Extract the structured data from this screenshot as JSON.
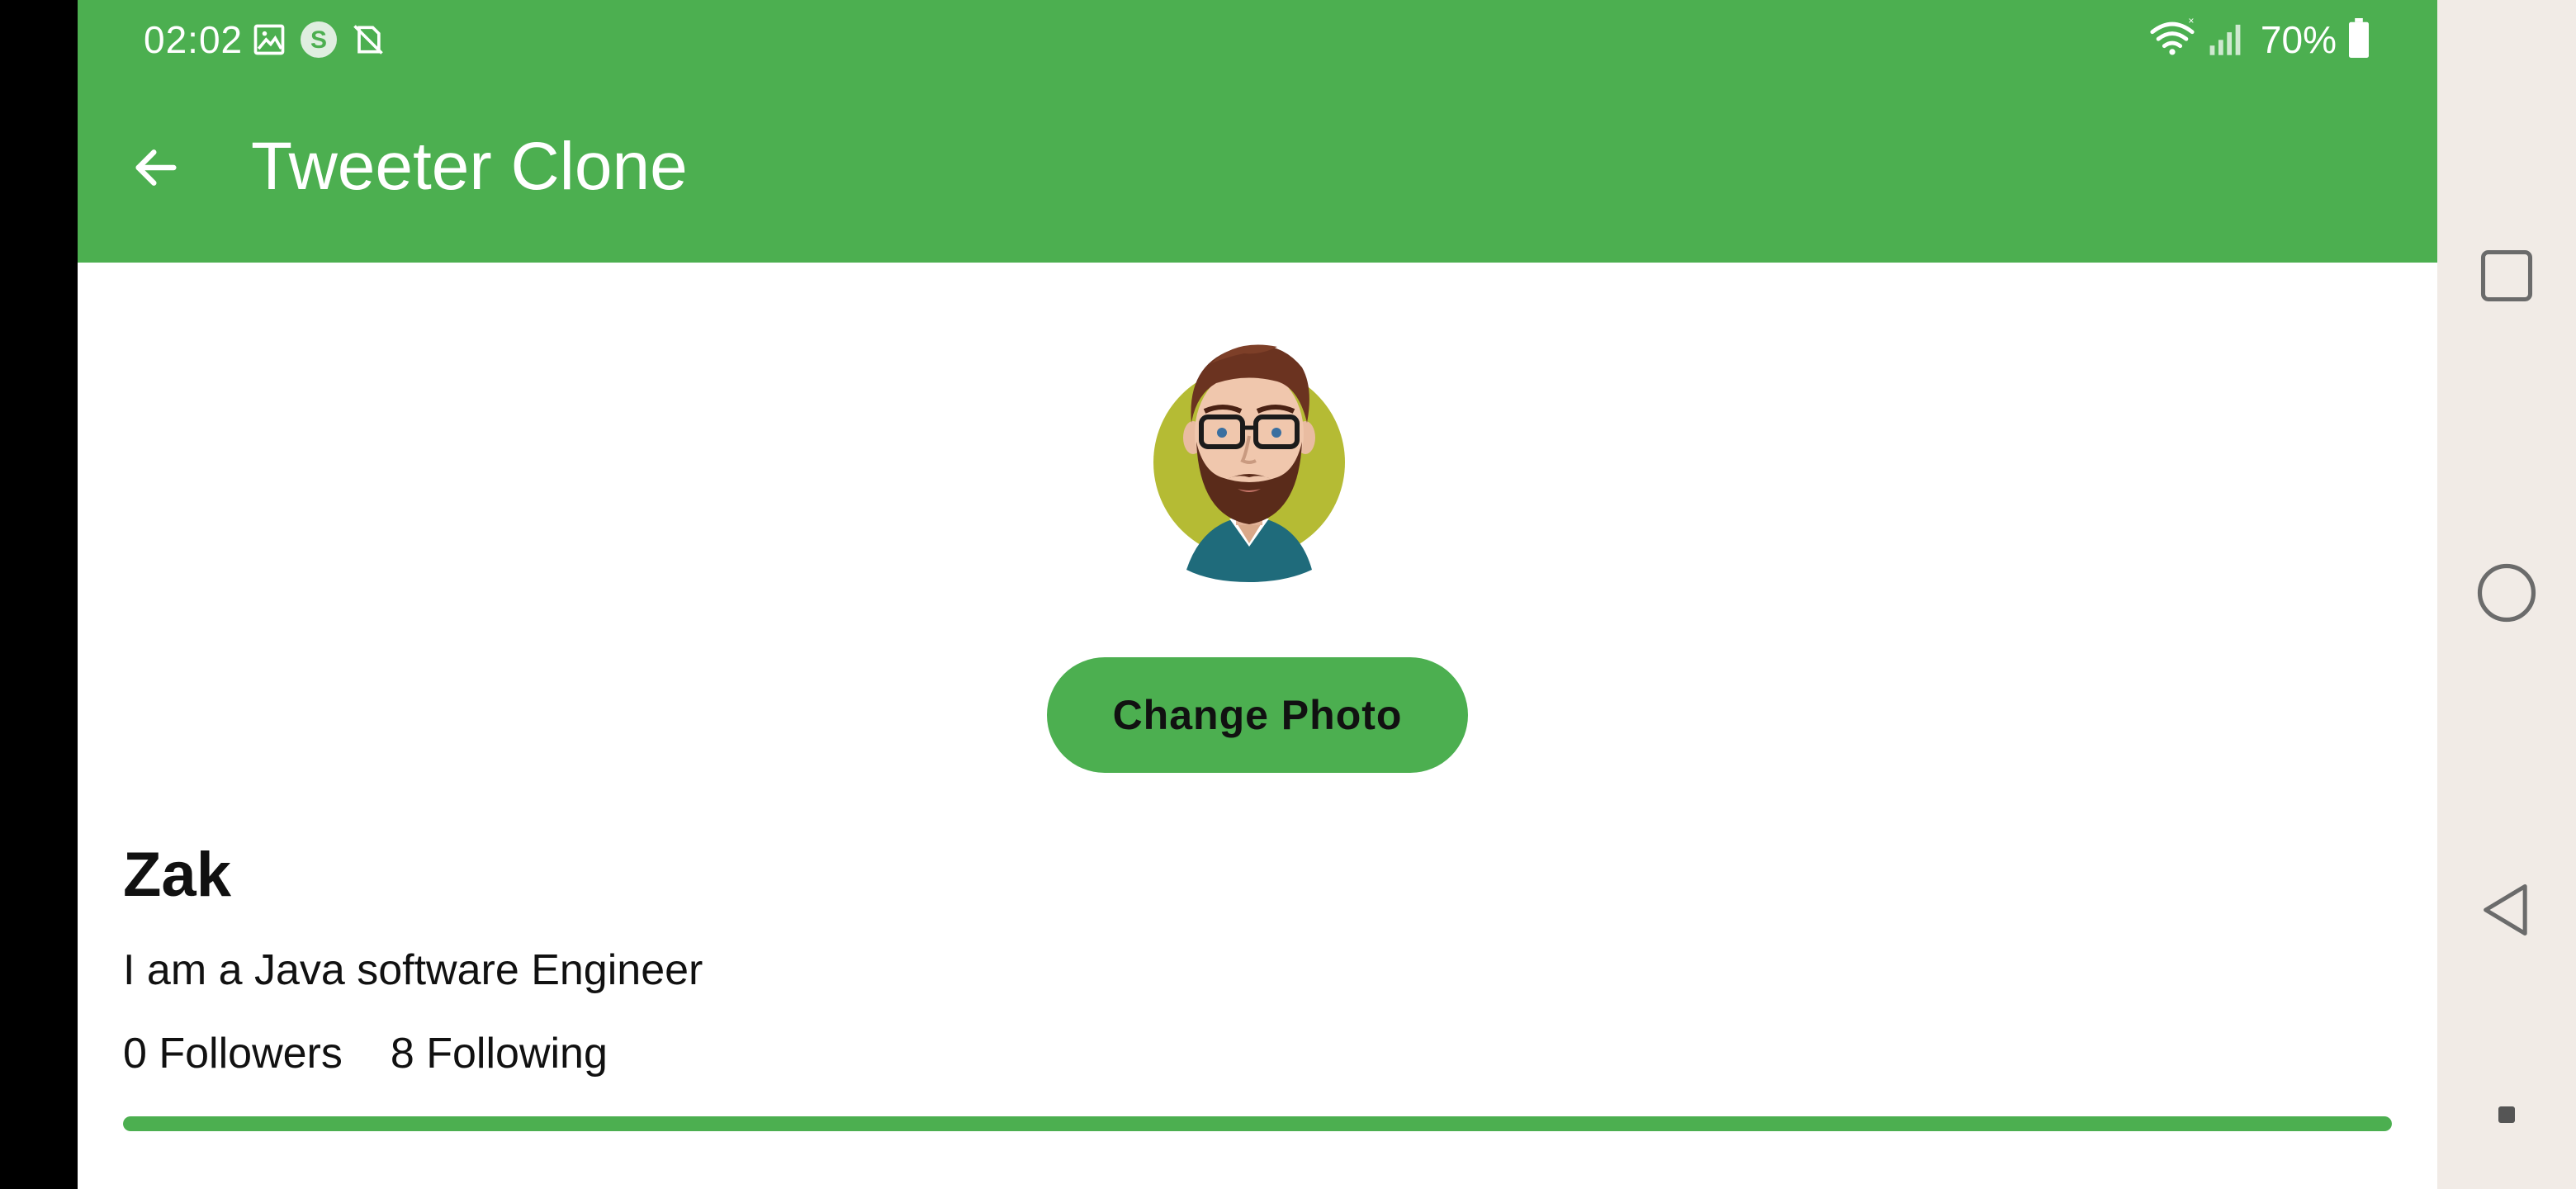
{
  "status_bar": {
    "time": "02:02",
    "battery_percent": "70%",
    "icons": [
      "image-icon",
      "skype-icon",
      "no-sim-icon",
      "wifi-icon",
      "signal-icon",
      "battery-icon"
    ]
  },
  "toolbar": {
    "title": "Tweeter Clone",
    "back_icon": "arrow-back-icon"
  },
  "profile": {
    "change_photo_label": "Change Photo",
    "name": "Zak",
    "bio": "I am a Java software Engineer",
    "followers": "0 Followers",
    "following": "8 Following",
    "progress": 1.0
  },
  "navigation_bar": {
    "icons": [
      "recents-square-icon",
      "home-circle-icon",
      "back-triangle-icon",
      "accessibility-dot-icon"
    ]
  },
  "colors": {
    "primary": "#4caf50",
    "background": "#ffffff",
    "nav_background": "#f1ebe6",
    "text": "#111111"
  }
}
